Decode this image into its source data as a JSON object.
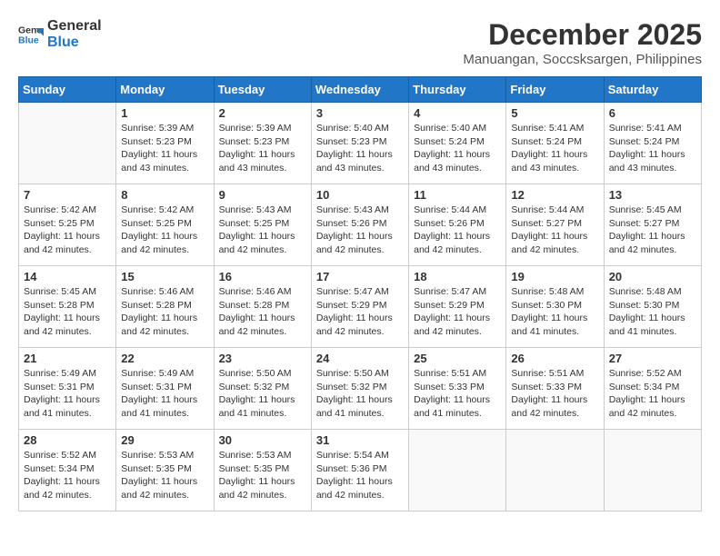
{
  "logo": {
    "line1": "General",
    "line2": "Blue"
  },
  "title": "December 2025",
  "location": "Manuangan, Soccsksargen, Philippines",
  "weekdays": [
    "Sunday",
    "Monday",
    "Tuesday",
    "Wednesday",
    "Thursday",
    "Friday",
    "Saturday"
  ],
  "weeks": [
    [
      {
        "day": "",
        "sunrise": "",
        "sunset": "",
        "daylight": ""
      },
      {
        "day": "1",
        "sunrise": "Sunrise: 5:39 AM",
        "sunset": "Sunset: 5:23 PM",
        "daylight": "Daylight: 11 hours and 43 minutes."
      },
      {
        "day": "2",
        "sunrise": "Sunrise: 5:39 AM",
        "sunset": "Sunset: 5:23 PM",
        "daylight": "Daylight: 11 hours and 43 minutes."
      },
      {
        "day": "3",
        "sunrise": "Sunrise: 5:40 AM",
        "sunset": "Sunset: 5:23 PM",
        "daylight": "Daylight: 11 hours and 43 minutes."
      },
      {
        "day": "4",
        "sunrise": "Sunrise: 5:40 AM",
        "sunset": "Sunset: 5:24 PM",
        "daylight": "Daylight: 11 hours and 43 minutes."
      },
      {
        "day": "5",
        "sunrise": "Sunrise: 5:41 AM",
        "sunset": "Sunset: 5:24 PM",
        "daylight": "Daylight: 11 hours and 43 minutes."
      },
      {
        "day": "6",
        "sunrise": "Sunrise: 5:41 AM",
        "sunset": "Sunset: 5:24 PM",
        "daylight": "Daylight: 11 hours and 43 minutes."
      }
    ],
    [
      {
        "day": "7",
        "sunrise": "Sunrise: 5:42 AM",
        "sunset": "Sunset: 5:25 PM",
        "daylight": "Daylight: 11 hours and 42 minutes."
      },
      {
        "day": "8",
        "sunrise": "Sunrise: 5:42 AM",
        "sunset": "Sunset: 5:25 PM",
        "daylight": "Daylight: 11 hours and 42 minutes."
      },
      {
        "day": "9",
        "sunrise": "Sunrise: 5:43 AM",
        "sunset": "Sunset: 5:25 PM",
        "daylight": "Daylight: 11 hours and 42 minutes."
      },
      {
        "day": "10",
        "sunrise": "Sunrise: 5:43 AM",
        "sunset": "Sunset: 5:26 PM",
        "daylight": "Daylight: 11 hours and 42 minutes."
      },
      {
        "day": "11",
        "sunrise": "Sunrise: 5:44 AM",
        "sunset": "Sunset: 5:26 PM",
        "daylight": "Daylight: 11 hours and 42 minutes."
      },
      {
        "day": "12",
        "sunrise": "Sunrise: 5:44 AM",
        "sunset": "Sunset: 5:27 PM",
        "daylight": "Daylight: 11 hours and 42 minutes."
      },
      {
        "day": "13",
        "sunrise": "Sunrise: 5:45 AM",
        "sunset": "Sunset: 5:27 PM",
        "daylight": "Daylight: 11 hours and 42 minutes."
      }
    ],
    [
      {
        "day": "14",
        "sunrise": "Sunrise: 5:45 AM",
        "sunset": "Sunset: 5:28 PM",
        "daylight": "Daylight: 11 hours and 42 minutes."
      },
      {
        "day": "15",
        "sunrise": "Sunrise: 5:46 AM",
        "sunset": "Sunset: 5:28 PM",
        "daylight": "Daylight: 11 hours and 42 minutes."
      },
      {
        "day": "16",
        "sunrise": "Sunrise: 5:46 AM",
        "sunset": "Sunset: 5:28 PM",
        "daylight": "Daylight: 11 hours and 42 minutes."
      },
      {
        "day": "17",
        "sunrise": "Sunrise: 5:47 AM",
        "sunset": "Sunset: 5:29 PM",
        "daylight": "Daylight: 11 hours and 42 minutes."
      },
      {
        "day": "18",
        "sunrise": "Sunrise: 5:47 AM",
        "sunset": "Sunset: 5:29 PM",
        "daylight": "Daylight: 11 hours and 42 minutes."
      },
      {
        "day": "19",
        "sunrise": "Sunrise: 5:48 AM",
        "sunset": "Sunset: 5:30 PM",
        "daylight": "Daylight: 11 hours and 41 minutes."
      },
      {
        "day": "20",
        "sunrise": "Sunrise: 5:48 AM",
        "sunset": "Sunset: 5:30 PM",
        "daylight": "Daylight: 11 hours and 41 minutes."
      }
    ],
    [
      {
        "day": "21",
        "sunrise": "Sunrise: 5:49 AM",
        "sunset": "Sunset: 5:31 PM",
        "daylight": "Daylight: 11 hours and 41 minutes."
      },
      {
        "day": "22",
        "sunrise": "Sunrise: 5:49 AM",
        "sunset": "Sunset: 5:31 PM",
        "daylight": "Daylight: 11 hours and 41 minutes."
      },
      {
        "day": "23",
        "sunrise": "Sunrise: 5:50 AM",
        "sunset": "Sunset: 5:32 PM",
        "daylight": "Daylight: 11 hours and 41 minutes."
      },
      {
        "day": "24",
        "sunrise": "Sunrise: 5:50 AM",
        "sunset": "Sunset: 5:32 PM",
        "daylight": "Daylight: 11 hours and 41 minutes."
      },
      {
        "day": "25",
        "sunrise": "Sunrise: 5:51 AM",
        "sunset": "Sunset: 5:33 PM",
        "daylight": "Daylight: 11 hours and 41 minutes."
      },
      {
        "day": "26",
        "sunrise": "Sunrise: 5:51 AM",
        "sunset": "Sunset: 5:33 PM",
        "daylight": "Daylight: 11 hours and 42 minutes."
      },
      {
        "day": "27",
        "sunrise": "Sunrise: 5:52 AM",
        "sunset": "Sunset: 5:34 PM",
        "daylight": "Daylight: 11 hours and 42 minutes."
      }
    ],
    [
      {
        "day": "28",
        "sunrise": "Sunrise: 5:52 AM",
        "sunset": "Sunset: 5:34 PM",
        "daylight": "Daylight: 11 hours and 42 minutes."
      },
      {
        "day": "29",
        "sunrise": "Sunrise: 5:53 AM",
        "sunset": "Sunset: 5:35 PM",
        "daylight": "Daylight: 11 hours and 42 minutes."
      },
      {
        "day": "30",
        "sunrise": "Sunrise: 5:53 AM",
        "sunset": "Sunset: 5:35 PM",
        "daylight": "Daylight: 11 hours and 42 minutes."
      },
      {
        "day": "31",
        "sunrise": "Sunrise: 5:54 AM",
        "sunset": "Sunset: 5:36 PM",
        "daylight": "Daylight: 11 hours and 42 minutes."
      },
      {
        "day": "",
        "sunrise": "",
        "sunset": "",
        "daylight": ""
      },
      {
        "day": "",
        "sunrise": "",
        "sunset": "",
        "daylight": ""
      },
      {
        "day": "",
        "sunrise": "",
        "sunset": "",
        "daylight": ""
      }
    ]
  ]
}
